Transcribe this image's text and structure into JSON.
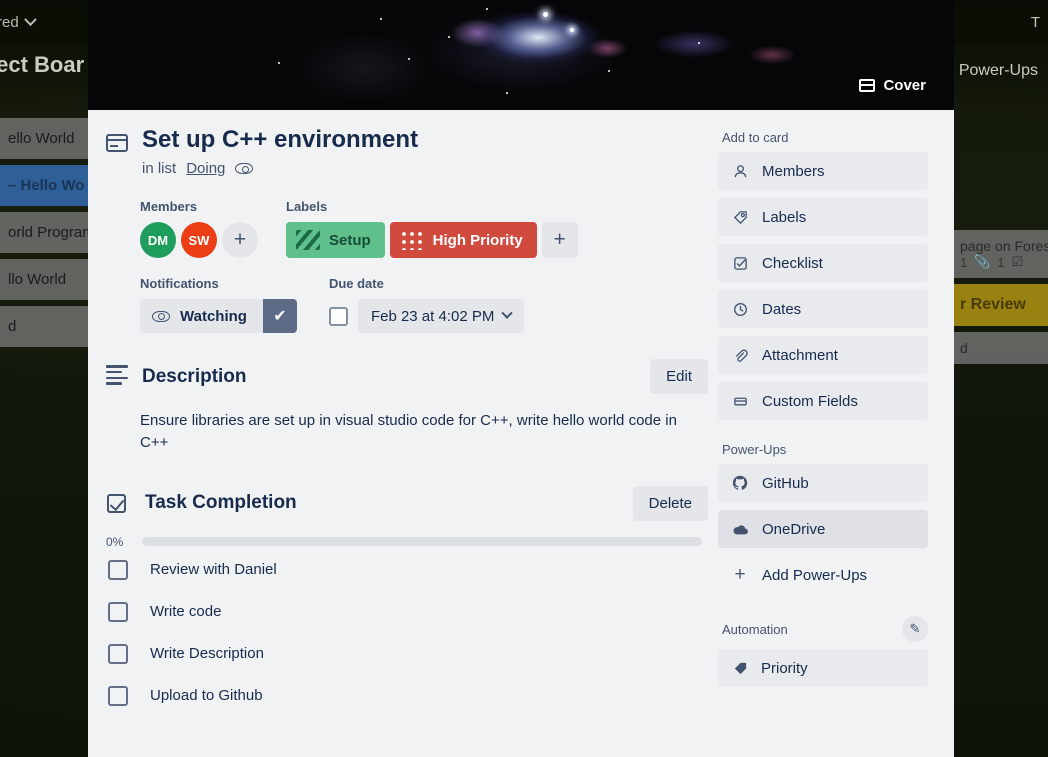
{
  "background": {
    "topbar": {
      "starred_label": "rred",
      "right_label": "T"
    },
    "board_title": "ject Boar",
    "powerups_label": "Power-Ups",
    "left_cards": [
      {
        "text": "ello World",
        "selected": false
      },
      {
        "text": "– Hello Wo",
        "selected": true
      },
      {
        "text": "orld Program",
        "selected": false
      },
      {
        "text": "llo World",
        "selected": false
      },
      {
        "text": "d",
        "selected": false
      }
    ],
    "right_card": {
      "text": "page on Fores",
      "badges": [
        "1",
        "1"
      ],
      "label": "r Review",
      "trailing": "d"
    }
  },
  "cover": {
    "button_label": "Cover",
    "icon": "cover-icon"
  },
  "card": {
    "icon": "card-icon",
    "title": "Set up C++ environment",
    "in_list_prefix": "in list",
    "list_name": "Doing",
    "watch_icon": "eye-icon"
  },
  "members": {
    "heading": "Members",
    "avatars": [
      {
        "initials": "DM",
        "color": "#1f9d5c"
      },
      {
        "initials": "SW",
        "color": "#eb3d16"
      }
    ],
    "add_label": "+"
  },
  "labels": {
    "heading": "Labels",
    "items": [
      {
        "text": "Setup",
        "color": "#5fc08b",
        "pattern": "stripes"
      },
      {
        "text": "High Priority",
        "color": "#d04a3e",
        "pattern": "dots"
      }
    ],
    "add_label": "+"
  },
  "notifications": {
    "heading": "Notifications",
    "watching_label": "Watching",
    "check_glyph": "✔",
    "eye_icon": "eye-icon"
  },
  "due_date": {
    "heading": "Due date",
    "checked": false,
    "value": "Feb 23 at 4:02 PM"
  },
  "description": {
    "heading": "Description",
    "edit_label": "Edit",
    "body": "Ensure libraries are set up in visual studio code for C++, write hello world code in C++"
  },
  "checklist": {
    "heading": "Task Completion",
    "delete_label": "Delete",
    "progress_label": "0%",
    "progress_value": 0,
    "items": [
      {
        "text": "Review with Daniel",
        "checked": false
      },
      {
        "text": "Write code",
        "checked": false
      },
      {
        "text": "Write Description",
        "checked": false
      },
      {
        "text": "Upload to Github",
        "checked": false
      }
    ]
  },
  "sidebar": {
    "add_to_card": {
      "heading": "Add to card",
      "items": [
        {
          "label": "Members",
          "icon": "person-icon"
        },
        {
          "label": "Labels",
          "icon": "tag-icon"
        },
        {
          "label": "Checklist",
          "icon": "checklist-icon"
        },
        {
          "label": "Dates",
          "icon": "clock-icon"
        },
        {
          "label": "Attachment",
          "icon": "paperclip-icon"
        },
        {
          "label": "Custom Fields",
          "icon": "fields-icon"
        }
      ]
    },
    "power_ups": {
      "heading": "Power-Ups",
      "items": [
        {
          "label": "GitHub",
          "icon": "github-icon"
        },
        {
          "label": "OneDrive",
          "icon": "cloud-icon"
        }
      ],
      "add_label": "Add Power-Ups"
    },
    "automation": {
      "heading": "Automation",
      "edit_icon": "pencil-icon",
      "items": [
        {
          "label": "Priority",
          "icon": "tag-icon"
        }
      ]
    }
  }
}
